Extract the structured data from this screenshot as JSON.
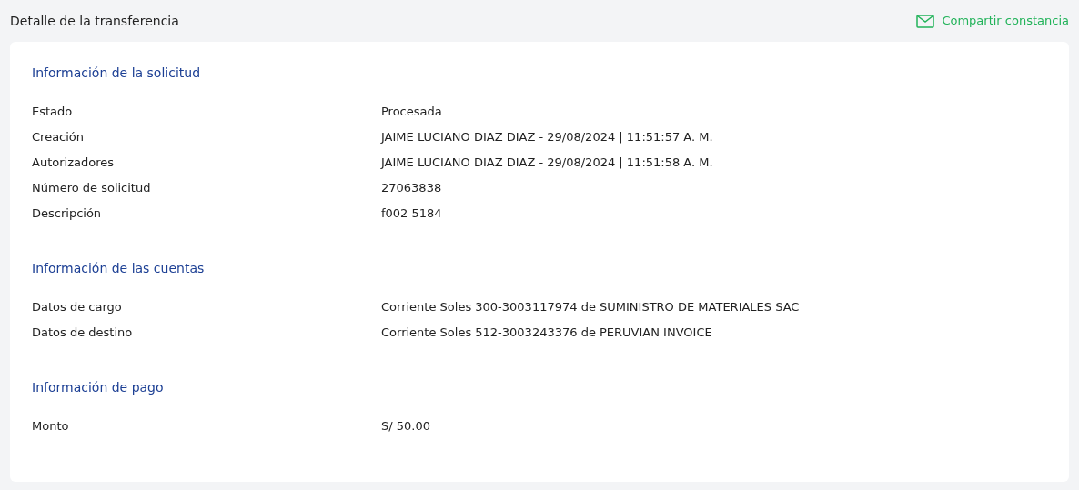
{
  "header": {
    "title": "Detalle de la transferencia",
    "share_link": "Compartir constancia"
  },
  "sections": [
    {
      "title": "Información de la solicitud",
      "rows": [
        {
          "label": "Estado",
          "value": "Procesada"
        },
        {
          "label": "Creación",
          "value": "JAIME LUCIANO DIAZ DIAZ - 29/08/2024 | 11:51:57 A. M."
        },
        {
          "label": "Autorizadores",
          "value": "JAIME LUCIANO DIAZ DIAZ - 29/08/2024 | 11:51:58 A. M."
        },
        {
          "label": "Número de solicitud",
          "value": "27063838"
        },
        {
          "label": "Descripción",
          "value": "f002 5184"
        }
      ]
    },
    {
      "title": "Información de las cuentas",
      "rows": [
        {
          "label": "Datos de cargo",
          "value": "Corriente Soles 300-3003117974 de SUMINISTRO DE MATERIALES SAC"
        },
        {
          "label": "Datos de destino",
          "value": "Corriente Soles 512-3003243376 de PERUVIAN INVOICE"
        }
      ]
    },
    {
      "title": "Información de pago",
      "rows": [
        {
          "label": "Monto",
          "value": "S/ 50.00"
        }
      ]
    }
  ]
}
